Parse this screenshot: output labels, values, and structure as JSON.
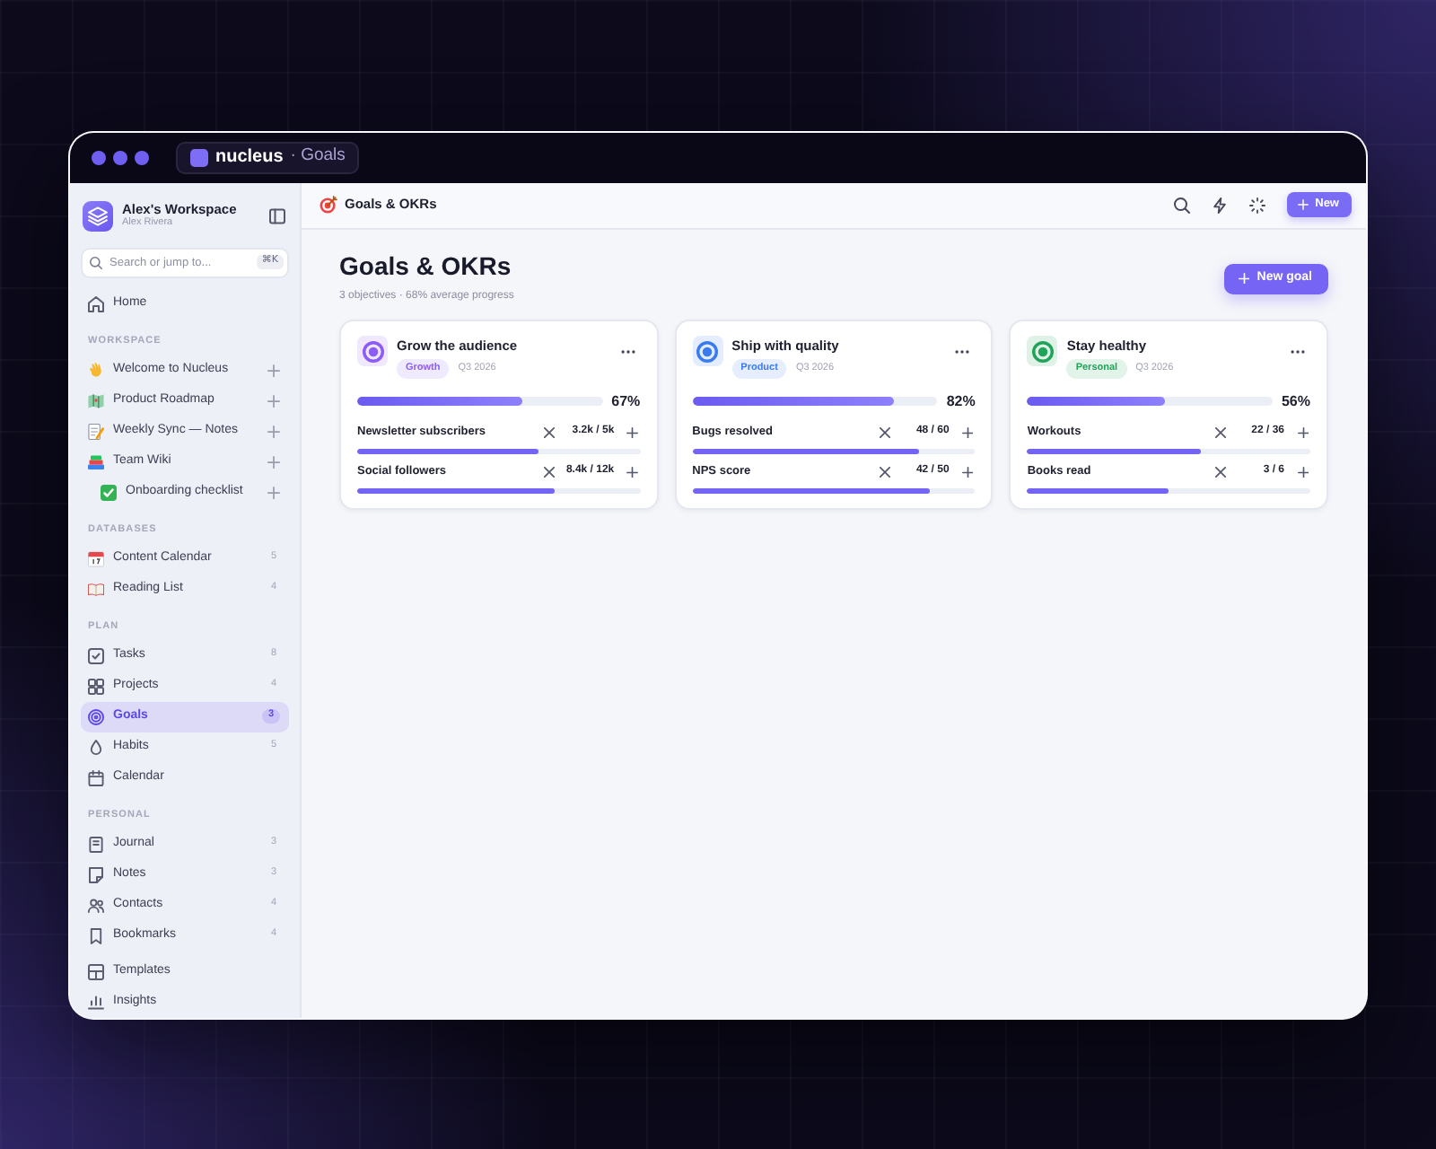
{
  "title_bar": {
    "app_name": "nucleus",
    "page": "· Goals"
  },
  "sidebar": {
    "workspace": {
      "name": "Alex's Workspace",
      "user": "Alex Rivera"
    },
    "search": {
      "placeholder": "Search or jump to...",
      "shortcut": "⌘K"
    },
    "sections": [
      {
        "kind": "links",
        "items": [
          {
            "label": "Home",
            "selected": false
          }
        ]
      },
      {
        "kind": "pages",
        "heading": "WORKSPACE",
        "items": [
          {
            "label": "Welcome to Nucleus",
            "selected": false
          },
          {
            "label": "Product Roadmap",
            "selected": false
          },
          {
            "label": "Weekly Sync — Notes",
            "selected": false
          },
          {
            "label": "Team Wiki",
            "selected": false,
            "children": [
              {
                "label": "Onboarding checklist",
                "selected": false
              }
            ]
          }
        ]
      },
      {
        "kind": "links",
        "heading": "DATABASES",
        "items": [
          {
            "label": "Content Calendar",
            "count": "5",
            "selected": false
          },
          {
            "label": "Reading List",
            "count": "4",
            "selected": false
          }
        ]
      },
      {
        "kind": "links",
        "heading": "PLAN",
        "items": [
          {
            "label": "Tasks",
            "count": "8",
            "selected": false
          },
          {
            "label": "Projects",
            "count": "4",
            "selected": false
          },
          {
            "label": "Goals",
            "count": "3",
            "selected": true
          },
          {
            "label": "Habits",
            "count": "5",
            "selected": false
          },
          {
            "label": "Calendar",
            "selected": false
          }
        ]
      },
      {
        "kind": "links",
        "heading": "PERSONAL",
        "items": [
          {
            "label": "Journal",
            "count": "3",
            "selected": false
          },
          {
            "label": "Notes",
            "count": "3",
            "selected": false
          },
          {
            "label": "Contacts",
            "count": "4",
            "selected": false
          },
          {
            "label": "Bookmarks",
            "count": "4",
            "selected": false
          }
        ]
      },
      {
        "kind": "links",
        "items": [
          {
            "label": "Templates",
            "selected": false
          },
          {
            "label": "Insights",
            "selected": false
          }
        ]
      }
    ]
  },
  "header": {
    "title": "Goals & OKRs",
    "new_button": "New"
  },
  "page": {
    "title": "Goals & OKRs",
    "subtitle": "3 objectives · 68% average progress",
    "new_goal_button": "New goal"
  },
  "objectives": [
    {
      "title": "Grow the audience",
      "tag": "Growth",
      "color": "#8b5cf6",
      "quarter": "Q3 2026",
      "level": 0.67,
      "percent": "67%",
      "key_results": [
        {
          "name": "Newsletter subscribers",
          "value": "3.2k / 5k",
          "level": 0.64
        },
        {
          "name": "Social followers",
          "value": "8.4k / 12k",
          "level": 0.7
        }
      ]
    },
    {
      "title": "Ship with quality",
      "tag": "Product",
      "color": "#3b7bf0",
      "quarter": "Q3 2026",
      "level": 0.82,
      "percent": "82%",
      "key_results": [
        {
          "name": "Bugs resolved",
          "value": "48 / 60",
          "level": 0.8
        },
        {
          "name": "NPS score",
          "value": "42 / 50",
          "level": 0.84
        }
      ]
    },
    {
      "title": "Stay healthy",
      "tag": "Personal",
      "color": "#22a35a",
      "quarter": "Q3 2026",
      "level": 0.56,
      "percent": "56%",
      "key_results": [
        {
          "name": "Workouts",
          "value": "22 / 36",
          "level": 0.61
        },
        {
          "name": "Books read",
          "value": "3 / 6",
          "level": 0.5
        }
      ]
    }
  ]
}
